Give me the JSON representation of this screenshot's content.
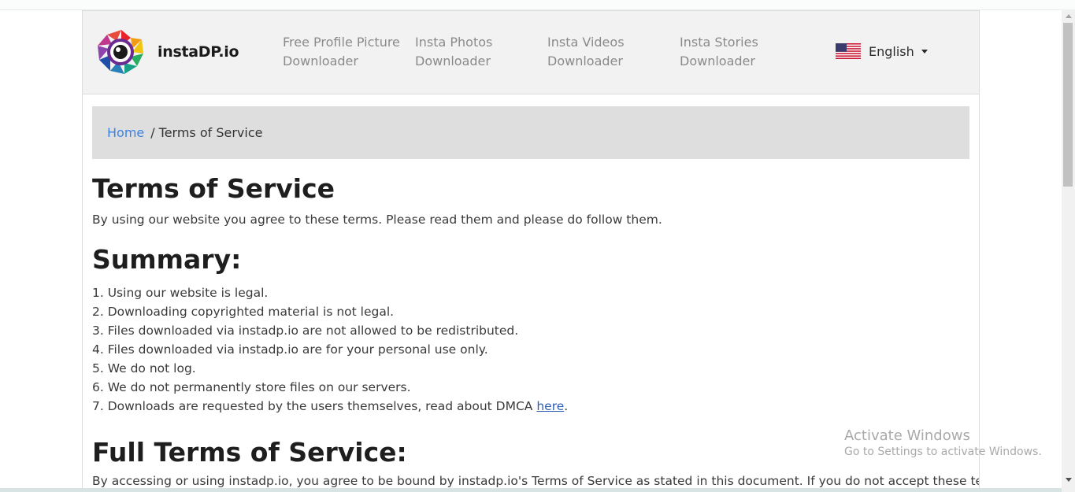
{
  "logo": {
    "text": "instaDP.io"
  },
  "nav": {
    "items": [
      {
        "line1": "Free Profile Picture",
        "line2": "Downloader"
      },
      {
        "line1": "Insta Photos",
        "line2": "Downloader"
      },
      {
        "line1": "Insta Videos",
        "line2": "Downloader"
      },
      {
        "line1": "Insta Stories",
        "line2": "Downloader"
      }
    ],
    "language": {
      "label": "English",
      "flag_icon": "us-flag-icon"
    }
  },
  "breadcrumb": {
    "home": "Home",
    "separator": "/",
    "current": "Terms of Service"
  },
  "content": {
    "title": "Terms of Service",
    "intro": "By using our website you agree to these terms. Please read them and please do follow them.",
    "summary_heading": "Summary:",
    "summary_items": [
      "1. Using our website is legal.",
      "2. Downloading copyrighted material is not legal.",
      "3. Files downloaded via instadp.io are not allowed to be redistributed.",
      "4. Files downloaded via instadp.io are for your personal use only.",
      "5. We do not log.",
      "6. We do not permanently store files on our servers."
    ],
    "summary_last_prefix": "7. Downloads are requested by the users themselves, read about DMCA ",
    "summary_last_link": "here",
    "summary_last_suffix": ".",
    "full_heading": "Full Terms of Service:",
    "full_text": "By accessing or using instadp.io, you agree to be bound by instadp.io's Terms of Service as stated in this document. If you do not accept these terms."
  },
  "watermark": {
    "line1": "Activate Windows",
    "line2": "Go to Settings to activate Windows."
  },
  "colors": {
    "link": "#3b82e8",
    "navbar_bg": "#f2f2f2",
    "breadcrumb_bg": "#dedede"
  }
}
